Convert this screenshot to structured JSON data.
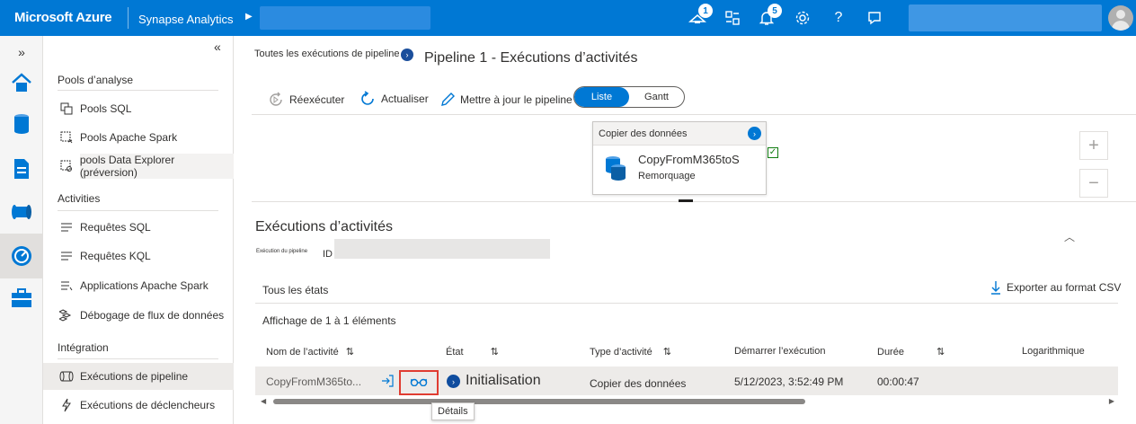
{
  "topbar": {
    "brand": "Microsoft Azure",
    "service": "Synapse Analytics",
    "notifications_badge_a": "1",
    "notifications_badge_b": "5"
  },
  "sidenav": {
    "sections": [
      {
        "heading": "Pools d’analyse",
        "items": [
          {
            "label": "Pools SQL",
            "icon": "sql-pool-icon"
          },
          {
            "label": "Pools Apache Spark",
            "icon": "spark-pool-icon"
          },
          {
            "label": "pools Data Explorer (préversion)",
            "icon": "data-explorer-pool-icon"
          }
        ]
      },
      {
        "heading": "Activities",
        "items": [
          {
            "label": "Requêtes SQL",
            "icon": "sql-requests-icon"
          },
          {
            "label": "Requêtes KQL",
            "icon": "kql-requests-icon"
          },
          {
            "label": "Applications Apache Spark",
            "icon": "spark-apps-icon"
          },
          {
            "label": "Débogage de flux de données",
            "icon": "dataflow-debug-icon"
          }
        ]
      },
      {
        "heading": "Intégration",
        "items": [
          {
            "label": "Exécutions de pipeline",
            "icon": "pipeline-runs-icon"
          },
          {
            "label": "Exécutions de déclencheurs",
            "icon": "trigger-runs-icon"
          }
        ]
      }
    ]
  },
  "main": {
    "breadcrumb": "Toutes les exécutions de pipeline",
    "title": "Pipeline 1 - Exécutions d’activités",
    "toolbar": {
      "rerun": "Réexécuter",
      "refresh": "Actualiser",
      "update": "Mettre à jour le pipeline"
    },
    "view_toggle": {
      "list": "Liste",
      "gantt": "Gantt",
      "selected": "Liste"
    },
    "activity_card": {
      "header": "Copier des données",
      "name": "CopyFromM365toS",
      "sub": "Remorquage"
    },
    "runs": {
      "title": "Exécutions d’activités",
      "pipeline_run_label": "Exécution du pipeline",
      "pipeline_run_id_label": "ID",
      "status_filter": "Tous les états",
      "export": "Exporter au format CSV",
      "count": "Affichage de 1 à 1 éléments",
      "columns": [
        "Nom de l’activité",
        "État",
        "Type d’activité",
        "Démarrer l’exécution",
        "Durée",
        "Logarithmique"
      ],
      "rows": [
        {
          "activity": "CopyFromM365to...",
          "status": "Initialisation",
          "type": "Copier des données",
          "start": "5/12/2023, 3:52:49 PM",
          "duration": "00:00:47"
        }
      ]
    },
    "tooltip": "Détails"
  }
}
